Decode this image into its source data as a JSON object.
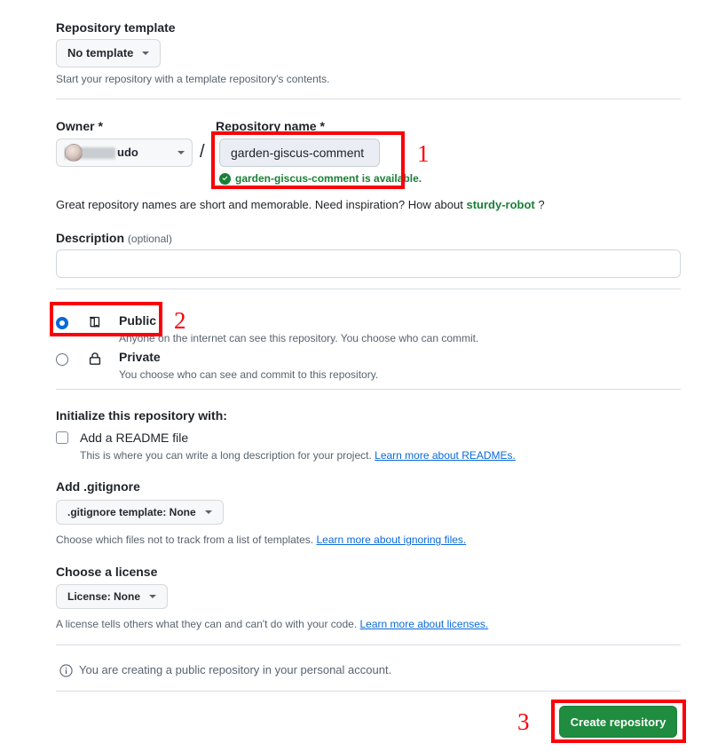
{
  "form": {
    "repository_template": {
      "label": "Repository template",
      "selected": "No template",
      "hint": "Start your repository with a template repository's contents."
    },
    "owner": {
      "label": "Owner *",
      "name_visible_suffix": "udo",
      "name_redacted": true
    },
    "separator": "/",
    "repository_name": {
      "label": "Repository name *",
      "value": "garden-giscus-comment",
      "placeholder": "",
      "availability_message": "garden-giscus-comment is available.",
      "availability_icon": "check-circle-icon",
      "availability_color": "#1a7f37"
    },
    "name_hint": {
      "prefix": "Great repository names are short and memorable. Need inspiration? How about ",
      "suggestion": "sturdy-robot",
      "suffix": " ?"
    },
    "description": {
      "label": "Description",
      "optional_tag": "(optional)",
      "value": "",
      "placeholder": ""
    },
    "visibility": {
      "options": [
        {
          "id": "public",
          "icon": "repo-book-icon",
          "title": "Public",
          "description": "Anyone on the internet can see this repository. You choose who can commit.",
          "selected": true
        },
        {
          "id": "private",
          "icon": "lock-icon",
          "title": "Private",
          "description": "You choose who can see and commit to this repository.",
          "selected": false
        }
      ]
    },
    "initialize": {
      "label": "Initialize this repository with:",
      "readme": {
        "label": "Add a README file",
        "checked": false,
        "hint_prefix": "This is where you can write a long description for your project. ",
        "hint_link": "Learn more about READMEs."
      }
    },
    "gitignore": {
      "label": "Add .gitignore",
      "selected": ".gitignore template: None",
      "hint_prefix": "Choose which files not to track from a list of templates. ",
      "hint_link": "Learn more about ignoring files."
    },
    "license": {
      "label": "Choose a license",
      "selected": "License: None",
      "hint_prefix": "A license tells others what they can and can't do with your code. ",
      "hint_link": "Learn more about licenses."
    },
    "account_note": {
      "icon": "info-icon",
      "text": "You are creating a public repository in your personal account."
    },
    "submit": {
      "label": "Create repository",
      "color": "#1f8c3f"
    }
  },
  "annotations": {
    "color": "#fb0007",
    "markers": [
      {
        "number": "1",
        "target": "repository-name-field"
      },
      {
        "number": "2",
        "target": "public-visibility-radio"
      },
      {
        "number": "3",
        "target": "create-repository-button"
      }
    ]
  }
}
